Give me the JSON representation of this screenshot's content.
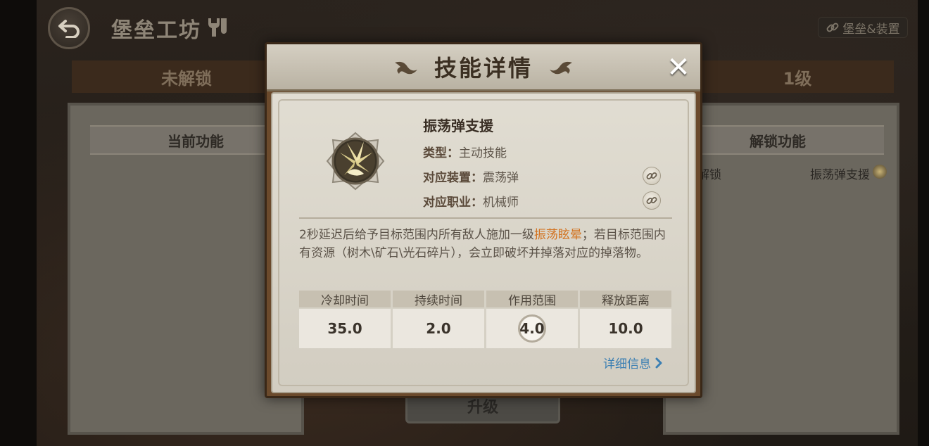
{
  "header": {
    "title": "堡垒工坊",
    "link_button": "堡垒&装置"
  },
  "tabs": {
    "left": "未解锁",
    "right": "1级"
  },
  "left_panel": {
    "heading": "当前功能"
  },
  "right_panel": {
    "heading": "解锁功能",
    "row_label": "能解锁",
    "row_value": "振荡弹支援"
  },
  "upgrade_button": "升级",
  "modal": {
    "title": "技能详情",
    "close": "✕",
    "skill_name": "振荡弹支援",
    "type_key": "类型：",
    "type_value": "主动技能",
    "device_key": "对应装置：",
    "device_value": "震荡弹",
    "job_key": "对应职业：",
    "job_value": "机械师",
    "desc_part1": "2秒延迟后给予目标范围内所有敌人施加一级",
    "desc_highlight": "振荡眩晕",
    "desc_part2": "；若目标范围内有资源（树木\\矿石\\光石碎片），会立即破坏并掉落对应的掉落物。",
    "stats": [
      {
        "label": "冷却时间",
        "value": "35.0"
      },
      {
        "label": "持续时间",
        "value": "2.0"
      },
      {
        "label": "作用范围",
        "value": "4.0"
      },
      {
        "label": "释放距离",
        "value": "10.0"
      }
    ],
    "detail_link": "详细信息",
    "highlight_color": "#d2721f"
  }
}
